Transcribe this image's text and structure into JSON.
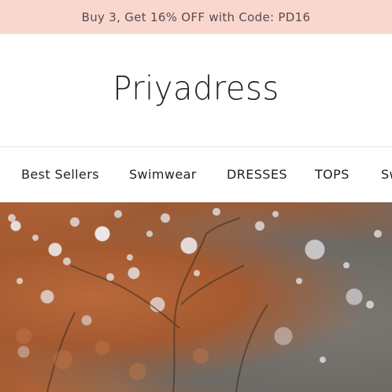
{
  "promo": {
    "text": "Buy 3, Get 16% OFF with Code: PD16"
  },
  "brand": {
    "logo_text": "Priyadress"
  },
  "nav": {
    "items": [
      {
        "label": "Best Sellers"
      },
      {
        "label": "Swimwear"
      },
      {
        "label": "DRESSES"
      },
      {
        "label": "TOPS"
      },
      {
        "label": "Sw"
      }
    ]
  },
  "colors": {
    "promo_background": "#f9d7cf",
    "promo_text": "#5a4a4e",
    "nav_text": "#222222",
    "divider": "#e6e6e6"
  },
  "hero": {
    "image": "autumn-trees-photo"
  }
}
